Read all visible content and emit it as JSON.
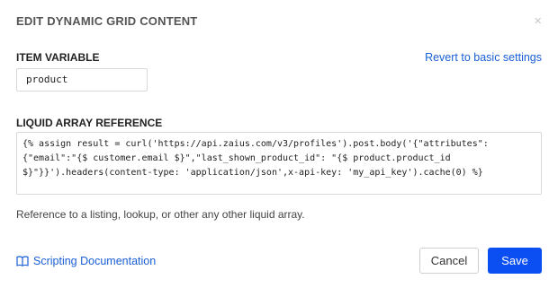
{
  "dialog": {
    "title": "EDIT DYNAMIC GRID CONTENT",
    "close_glyph": "×"
  },
  "item_variable": {
    "label": "ITEM VARIABLE",
    "value": "product",
    "revert_link": "Revert to basic settings"
  },
  "liquid": {
    "label": "LIQUID ARRAY REFERENCE",
    "value": "{% assign result = curl('https://api.zaius.com/v3/profiles').post.body('{\"attributes\":\n{\"email\":\"{$ customer.email $}\",\"last_shown_product_id\": \"{$ product.product_id\n$}\"}}').headers(content-type: 'application/json',x-api-key: 'my_api_key').cache(0) %}",
    "hint": "Reference to a listing, lookup, or other any other liquid array."
  },
  "footer": {
    "docs_link": "Scripting Documentation",
    "docs_icon": "book-icon",
    "cancel_label": "Cancel",
    "save_label": "Save"
  },
  "colors": {
    "accent": "#0b4ff2",
    "link": "#1a5fd6"
  }
}
